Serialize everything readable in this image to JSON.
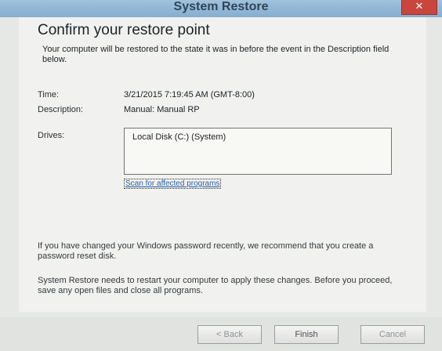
{
  "window": {
    "title": "System Restore",
    "close_symbol": "✕"
  },
  "main": {
    "heading": "Confirm your restore point",
    "intro": "Your computer will be restored to the state it was in before the event in the Description field below.",
    "time_label": "Time:",
    "time_value": "3/21/2015 7:19:45 AM (GMT-8:00)",
    "description_label": "Description:",
    "description_value": "Manual: Manual RP",
    "drives_label": "Drives:",
    "drives": [
      "Local Disk (C:) (System)"
    ],
    "scan_link": "Scan for affected programs",
    "password_note": "If you have changed your Windows password recently, we recommend that you create a password reset disk.",
    "restart_note": "System Restore needs to restart your computer to apply these changes. Before you proceed, save any open files and close all programs."
  },
  "buttons": {
    "back": "< Back",
    "finish": "Finish",
    "cancel": "Cancel"
  },
  "icons": {
    "close": "close-icon"
  }
}
